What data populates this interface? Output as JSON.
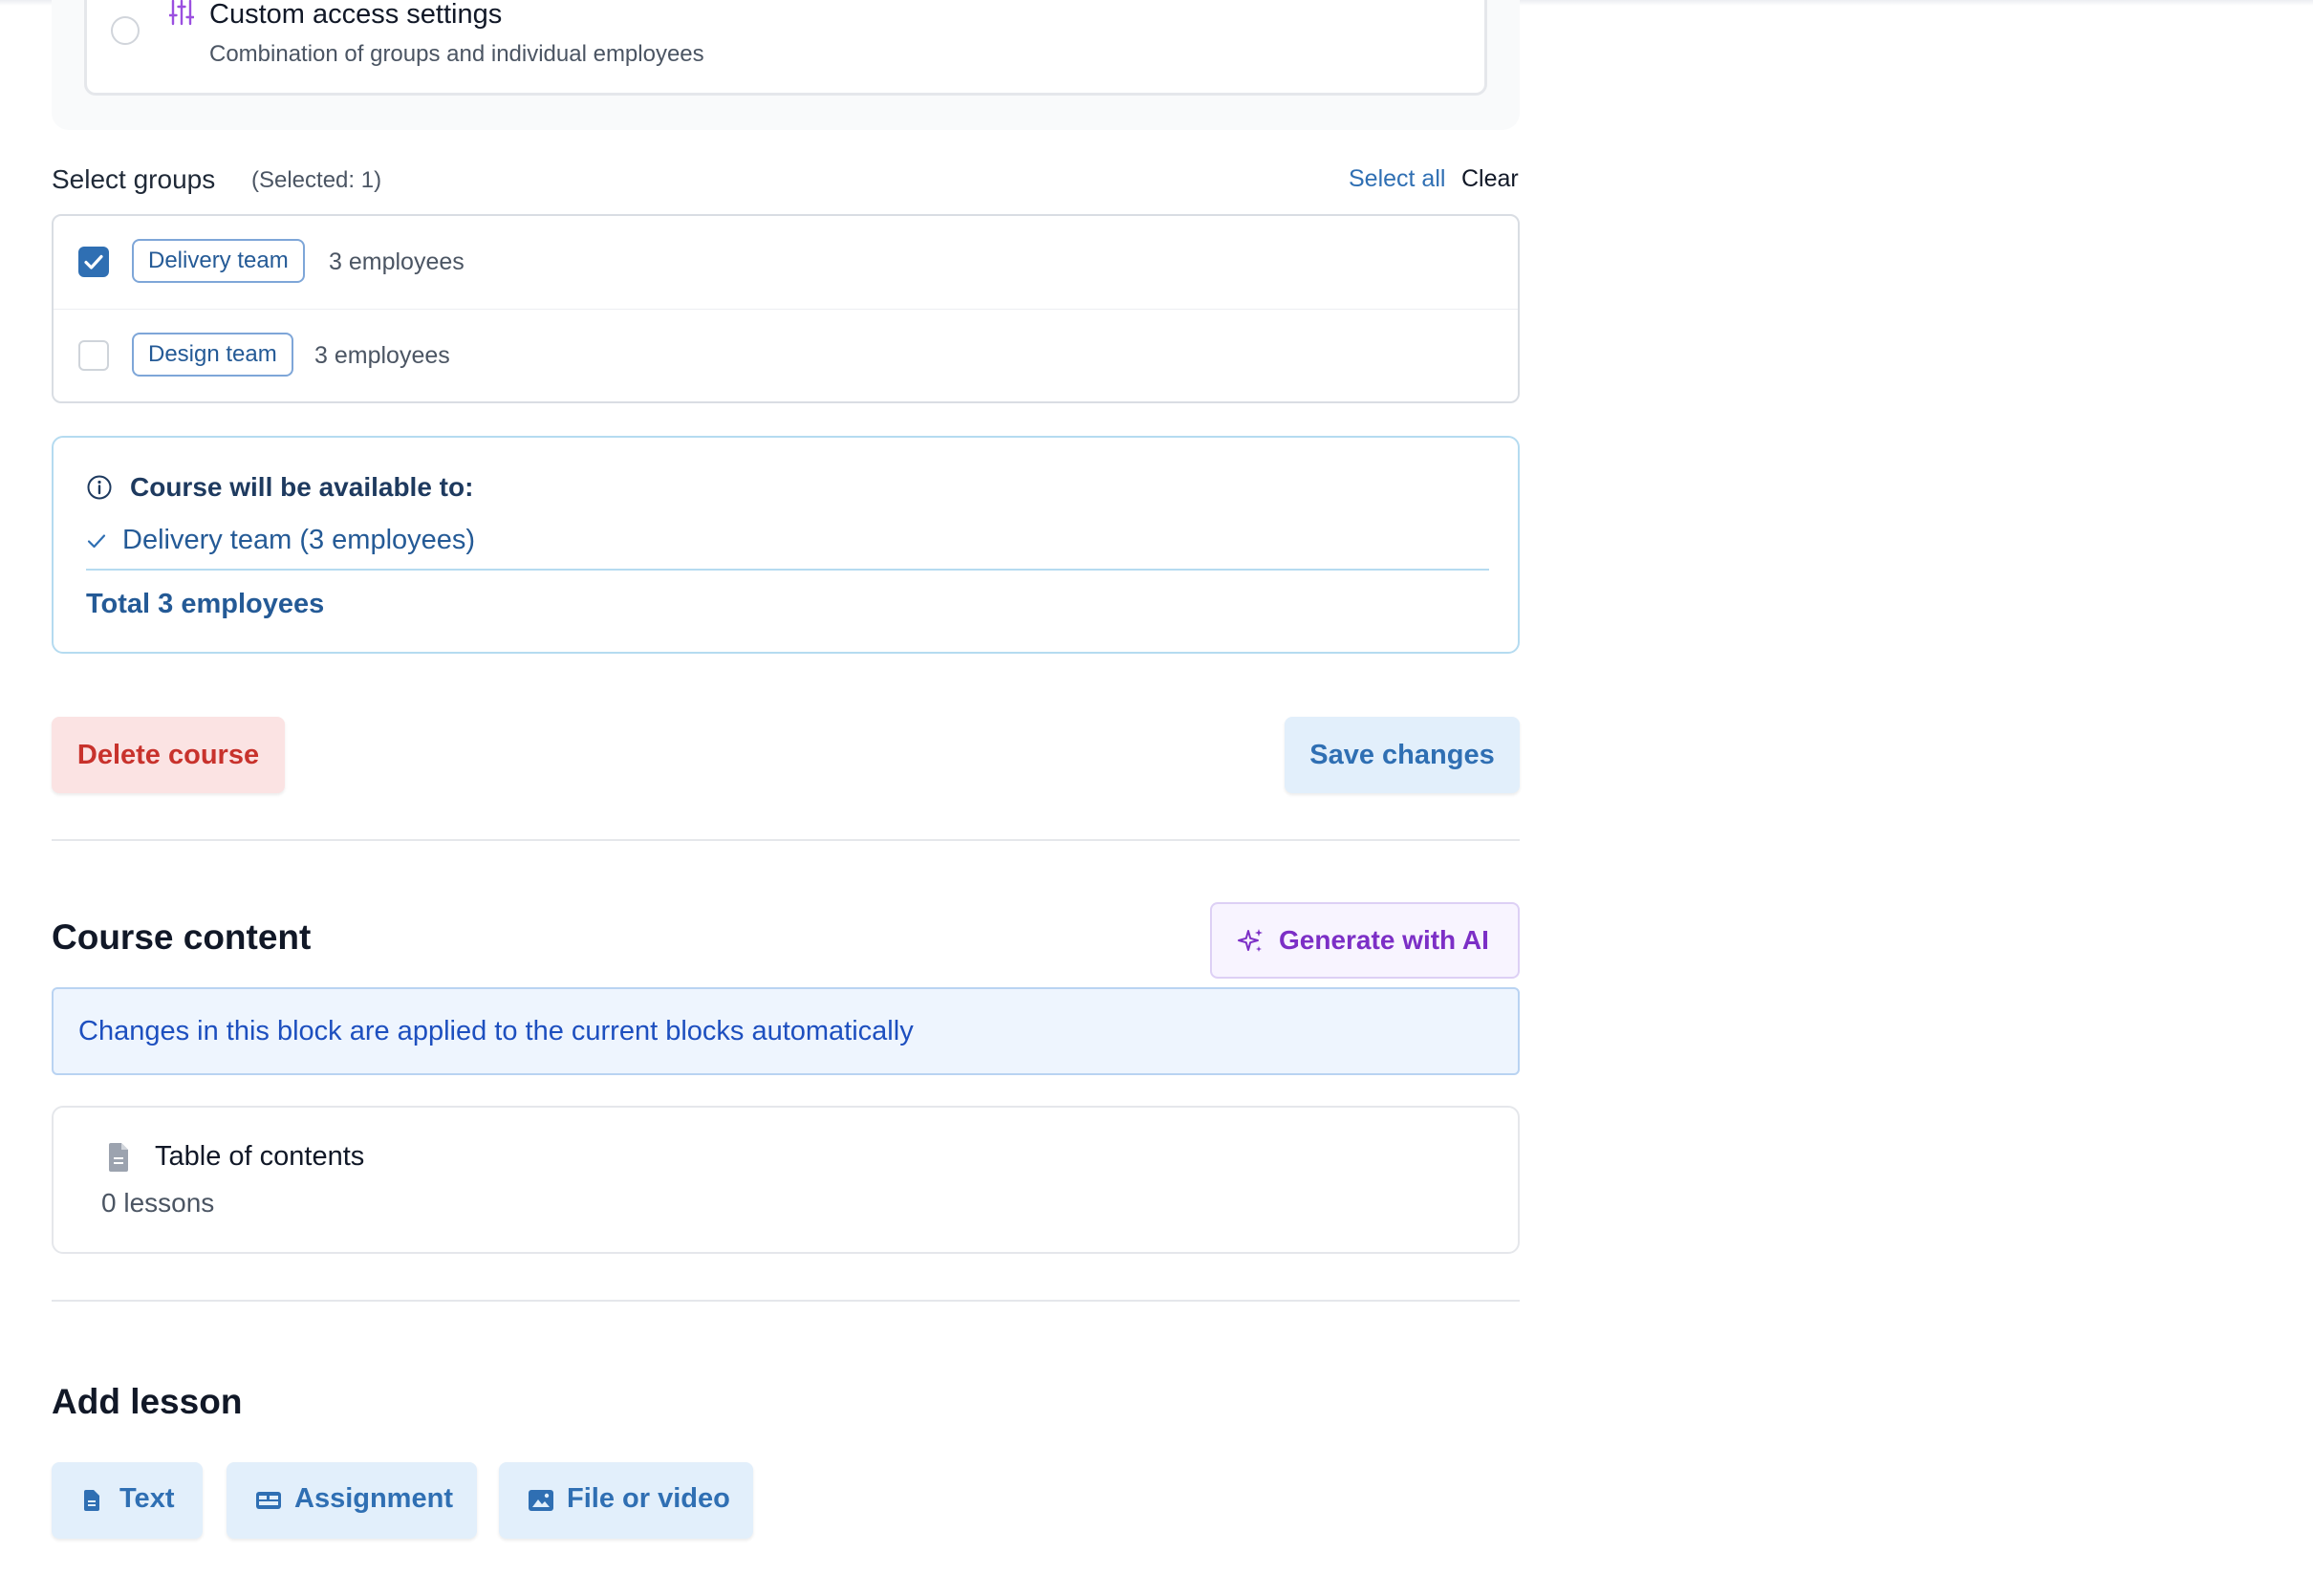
{
  "access_option": {
    "title": "Custom access settings",
    "subtitle": "Combination of groups and individual employees",
    "icon": "sliders-icon"
  },
  "select_groups": {
    "title": "Select groups",
    "selected_count": "(Selected: 1)",
    "select_all": "Select all",
    "clear": "Clear",
    "groups": [
      {
        "name": "Delivery team",
        "count": "3 employees",
        "checked": true
      },
      {
        "name": "Design team",
        "count": "3 employees",
        "checked": false
      }
    ]
  },
  "availability": {
    "title": "Course will be available to:",
    "items": [
      "Delivery team (3 employees)"
    ],
    "total": "Total 3 employees"
  },
  "actions": {
    "delete": "Delete course",
    "save": "Save changes"
  },
  "course_content": {
    "title": "Course content",
    "generate_ai": "Generate with AI",
    "note": "Changes in this block are applied to the current blocks automatically",
    "toc_title": "Table of contents",
    "toc_count": "0 lessons"
  },
  "add_lesson": {
    "title": "Add lesson",
    "buttons": [
      {
        "label": "Text",
        "icon": "document-icon"
      },
      {
        "label": "Assignment",
        "icon": "assignment-icon"
      },
      {
        "label": "File or video",
        "icon": "image-icon"
      }
    ]
  },
  "colors": {
    "accent": "#2f6fb3",
    "danger": "#c8322c",
    "ai_purple": "#7c2fc6",
    "info_blue": "#1d4fbf"
  }
}
